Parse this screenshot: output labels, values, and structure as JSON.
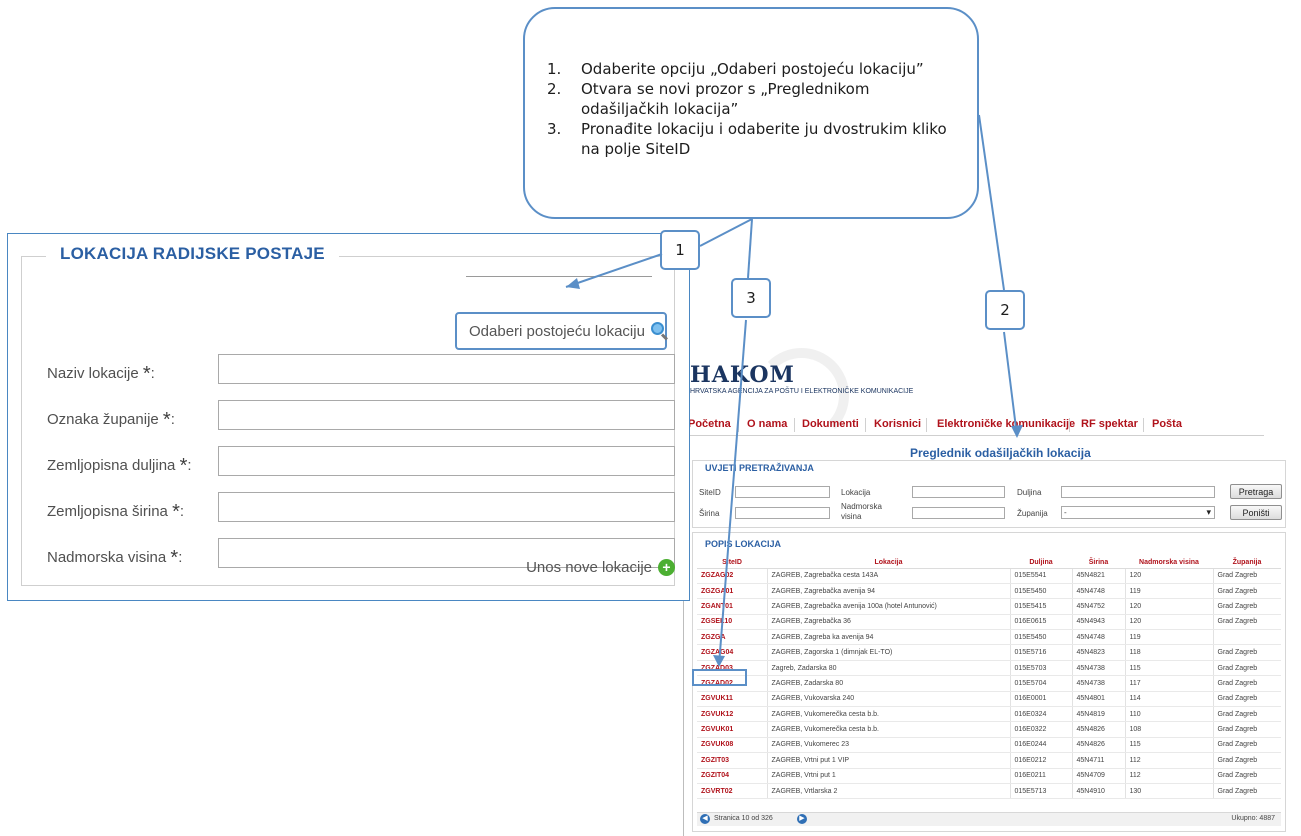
{
  "callout": {
    "steps": [
      {
        "num": "1.",
        "text": "Odaberite opciju „Odaberi postojeću lokaciju”"
      },
      {
        "num": "2.",
        "text": "Otvara se novi prozor s „Preglednikom odašiljačkih lokacija”"
      },
      {
        "num": "3.",
        "text": "Pronađite lokaciju i odaberite ju dvostrukim kliko na polje SiteID"
      }
    ]
  },
  "markers": {
    "m1": "1",
    "m2": "2",
    "m3": "3"
  },
  "form": {
    "title": "LOKACIJA RADIJSKE POSTAJE",
    "pick_existing": "Odaberi postojeću lokaciju",
    "star": "*",
    "fields": [
      {
        "label": "Naziv lokacije",
        "value": ""
      },
      {
        "label": "Oznaka županije",
        "value": ""
      },
      {
        "label": "Zemljopisna duljina",
        "value": ""
      },
      {
        "label": "Zemljopisna širina",
        "value": ""
      },
      {
        "label": "Nadmorska visina",
        "value": ""
      }
    ],
    "new_location": "Unos nove lokacije"
  },
  "browser": {
    "logo": "HAKOM",
    "logo_sub": "HRVATSKA AGENCIJA ZA POŠTU I ELEKTRONIČKE KOMUNIKACIJE",
    "nav": [
      "Početna",
      "O nama",
      "Dokumenti",
      "Korisnici",
      "Elektroničke komunikacije",
      "RF spektar",
      "Pošta"
    ],
    "title": "Preglednik odašiljačkih lokacija",
    "criteria": {
      "title": "UVJETI PRETRAŽIVANJA",
      "site_id": "SiteID",
      "lokacija": "Lokacija",
      "duljina": "Duljina",
      "sirina": "Širina",
      "nadmorska_1": "Nadmorska",
      "nadmorska_2": "visina",
      "zupanija": "Županija",
      "zupanija_value": "-",
      "search_button": "Pretraga",
      "reset_button": "Poništi"
    },
    "list": {
      "title": "POPIS LOKACIJA",
      "columns": [
        "SiteID",
        "Lokacija",
        "Duljina",
        "Širina",
        "Nadmorska visina",
        "Županija"
      ],
      "rows": [
        [
          "ZGZAG02",
          "ZAGREB, Zagrebačka cesta 143A",
          "015E5541",
          "45N4821",
          "120",
          "Grad Zagreb"
        ],
        [
          "ZGZGA01",
          "ZAGREB, Zagrebačka avenija 94",
          "015E5450",
          "45N4748",
          "119",
          "Grad Zagreb"
        ],
        [
          "ZGANT01",
          "ZAGREB, Zagrebačka avenija 100a (hotel Antunović)",
          "015E5415",
          "45N4752",
          "120",
          "Grad Zagreb"
        ],
        [
          "ZGSEL10",
          "ZAGREB, Zagrebačka 36",
          "016E0615",
          "45N4943",
          "120",
          "Grad Zagreb"
        ],
        [
          "ZGZGA",
          "ZAGREB, Zagreba ka avenija 94",
          "015E5450",
          "45N4748",
          "119",
          ""
        ],
        [
          "ZGZAG04",
          "ZAGREB, Zagorska 1 (dimnjak EL-TO)",
          "015E5716",
          "45N4823",
          "118",
          "Grad Zagreb"
        ],
        [
          "ZGZAD03",
          "Zagreb, Zadarska 80",
          "015E5703",
          "45N4738",
          "115",
          "Grad Zagreb"
        ],
        [
          "ZGZAD02",
          "ZAGREB, Zadarska 80",
          "015E5704",
          "45N4738",
          "117",
          "Grad Zagreb"
        ],
        [
          "ZGVUK11",
          "ZAGREB, Vukovarska 240",
          "016E0001",
          "45N4801",
          "114",
          "Grad Zagreb"
        ],
        [
          "ZGVUK12",
          "ZAGREB, Vukomerečka cesta b.b.",
          "016E0324",
          "45N4819",
          "110",
          "Grad Zagreb"
        ],
        [
          "ZGVUK01",
          "ZAGREB, Vukomerečka cesta b.b.",
          "016E0322",
          "45N4826",
          "108",
          "Grad Zagreb"
        ],
        [
          "ZGVUK08",
          "ZAGREB, Vukomerec 23",
          "016E0244",
          "45N4826",
          "115",
          "Grad Zagreb"
        ],
        [
          "ZGZIT03",
          "ZAGREB, Vrtni put 1 VIP",
          "016E0212",
          "45N4711",
          "112",
          "Grad Zagreb"
        ],
        [
          "ZGZIT04",
          "ZAGREB, Vrtni put 1",
          "016E0211",
          "45N4709",
          "112",
          "Grad Zagreb"
        ],
        [
          "ZGVRT02",
          "ZAGREB, Vrtlarska 2",
          "015E5713",
          "45N4910",
          "130",
          "Grad Zagreb"
        ]
      ],
      "pager": "Stranica 10 od 326",
      "total": "Ukupno: 4887"
    }
  },
  "colors": {
    "callout_border": "#5b8fc7",
    "form_title": "#2b5fa3",
    "link_red": "#b0121b",
    "plus_green": "#4caf32"
  }
}
